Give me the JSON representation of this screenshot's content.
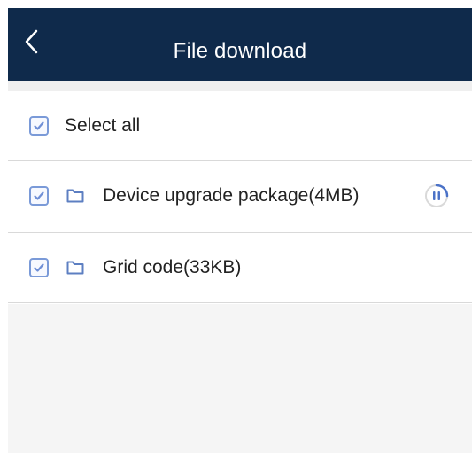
{
  "header": {
    "title": "File download",
    "back_icon": "chevron-left-icon",
    "background_color": "#0f2a4b"
  },
  "select_all": {
    "label": "Select all",
    "checked": true
  },
  "files": [
    {
      "name": "Device upgrade package(4MB)",
      "checked": true,
      "icon": "folder-icon",
      "status_icon": "pause-icon"
    },
    {
      "name": "Grid code(33KB)",
      "checked": true,
      "icon": "folder-icon"
    }
  ],
  "colors": {
    "checkbox_accent": "#6f8fd6",
    "divider": "#d9d9d9",
    "empty_area": "#f5f5f5"
  }
}
